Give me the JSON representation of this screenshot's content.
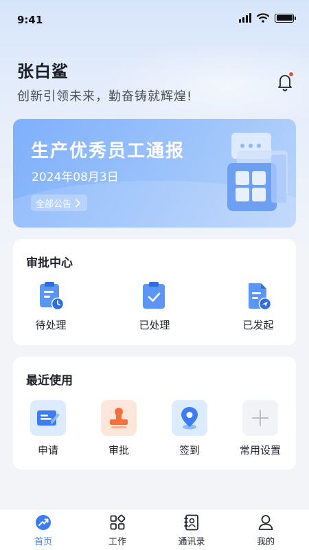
{
  "status_bar": {
    "time": "9:41"
  },
  "header": {
    "user_name": "张白鲨",
    "slogan": "创新引领未来，勤奋铸就辉煌!",
    "has_unread_notification": true
  },
  "banner": {
    "title": "生产优秀员工通报",
    "date": "2024年08月3日",
    "link_label": "全部公告"
  },
  "approval_center": {
    "title": "审批中心",
    "items": [
      {
        "label": "待处理",
        "icon": "clipboard-clock-icon"
      },
      {
        "label": "已处理",
        "icon": "clipboard-check-icon"
      },
      {
        "label": "已发起",
        "icon": "document-send-icon"
      }
    ]
  },
  "recent": {
    "title": "最近使用",
    "items": [
      {
        "label": "申请",
        "icon": "form-edit-icon",
        "color": "#3c7cf4"
      },
      {
        "label": "审批",
        "icon": "stamp-icon",
        "color": "#f5703c"
      },
      {
        "label": "签到",
        "icon": "map-pin-icon",
        "color": "#3c7cf4"
      },
      {
        "label": "常用设置",
        "icon": "plus-icon",
        "color": "#b9bec6"
      }
    ]
  },
  "tabbar": {
    "active": "首页",
    "items": [
      {
        "label": "首页",
        "icon": "home-compass-icon"
      },
      {
        "label": "工作",
        "icon": "apps-icon"
      },
      {
        "label": "通讯录",
        "icon": "contacts-icon"
      },
      {
        "label": "我的",
        "icon": "user-icon"
      }
    ]
  },
  "colors": {
    "accent": "#3c7cf4",
    "banner": "#8bb8fb",
    "background": "#f3f4f8"
  }
}
